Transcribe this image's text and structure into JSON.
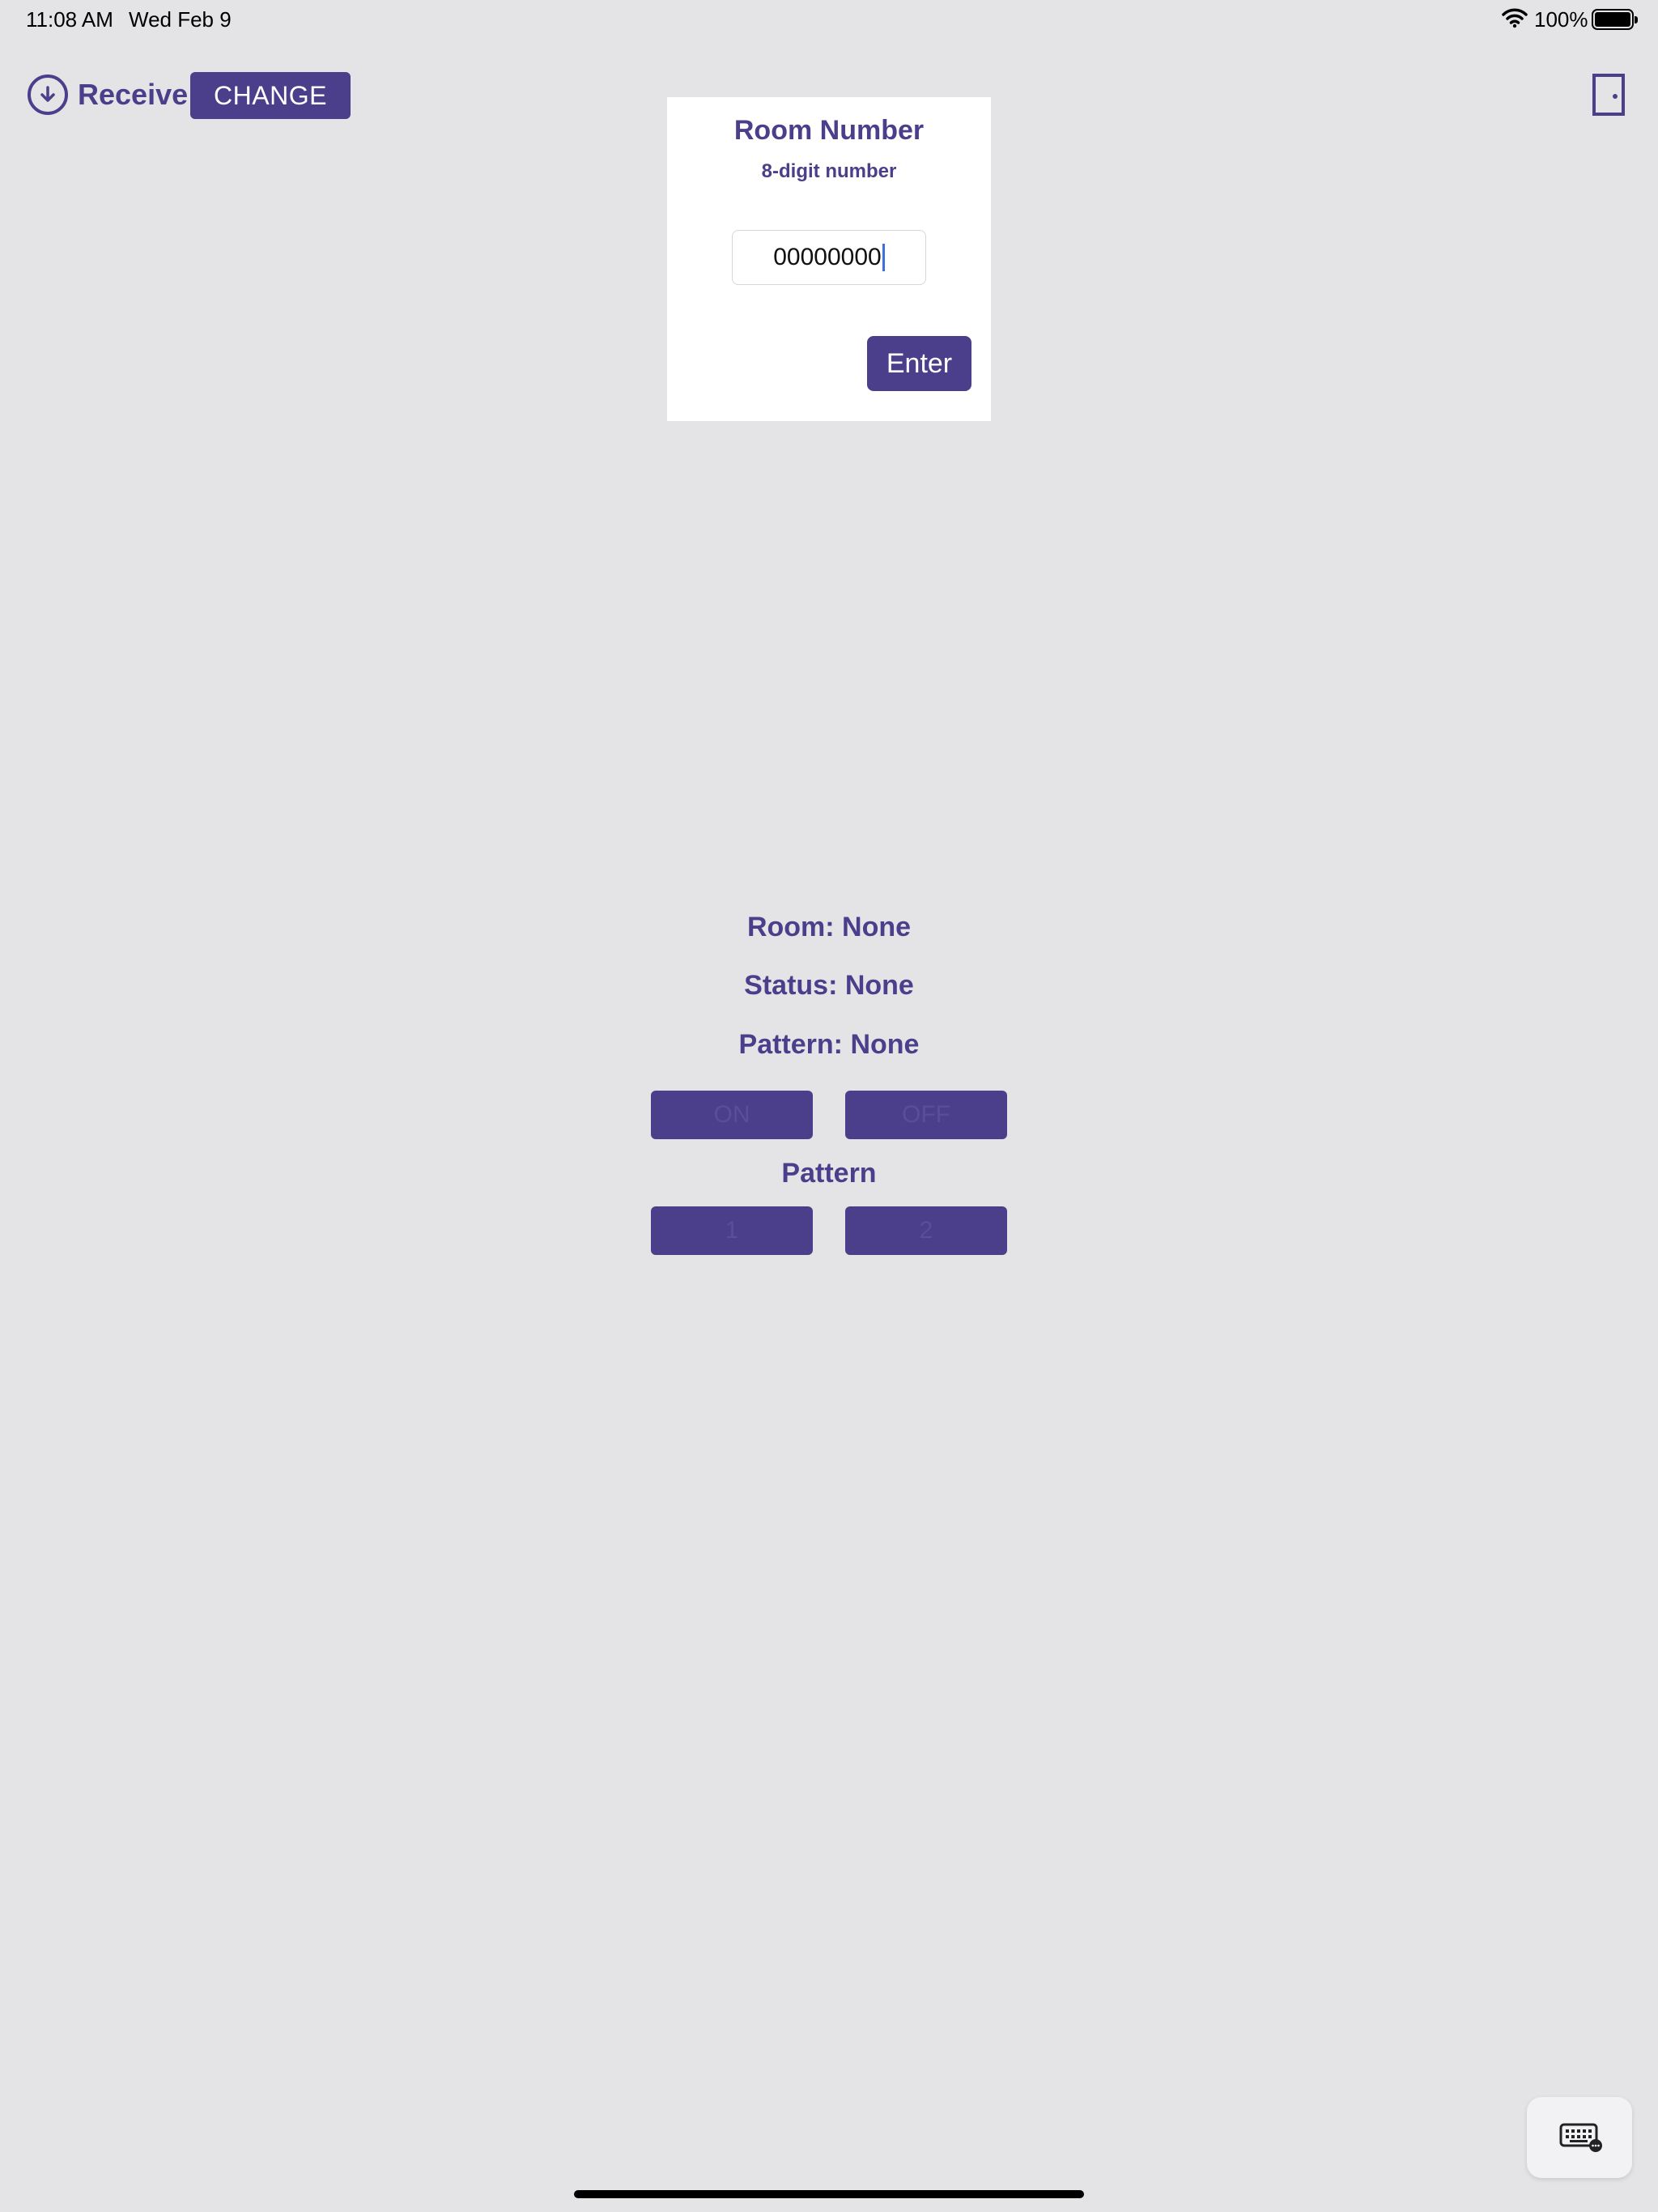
{
  "status_bar": {
    "time": "11:08 AM",
    "date": "Wed Feb 9",
    "battery": "100%",
    "battery_level": 1.0
  },
  "toolbar": {
    "receive_label": "Receive",
    "change_label": "CHANGE",
    "icons": [
      "receive-download-icon",
      "door-icon"
    ]
  },
  "room_dialog": {
    "title": "Room Number",
    "subtitle": "8-digit number",
    "input_value": "00000000",
    "enter_label": "Enter"
  },
  "info": {
    "room": "Room: None",
    "status": "Status: None",
    "pattern": "Pattern: None",
    "pattern_heading": "Pattern"
  },
  "buttons": {
    "on": "ON",
    "off": "OFF",
    "pattern_1": "1",
    "pattern_2": "2"
  },
  "colors": {
    "accent": "#4b3f8c",
    "background": "#e4e4e7",
    "caret": "#3d6fe0"
  }
}
